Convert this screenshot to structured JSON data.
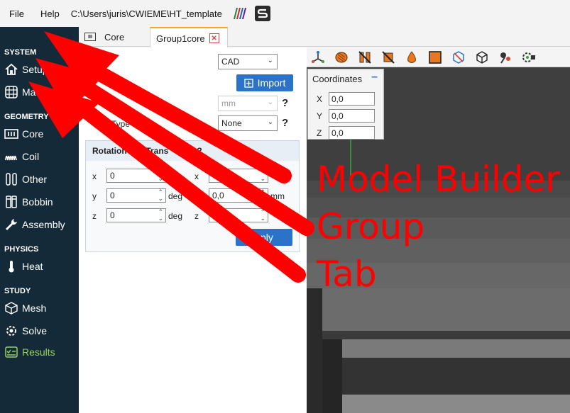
{
  "menubar": {
    "file": "File",
    "help": "Help",
    "path": "C:\\Users\\juris\\CWIEME\\HT_template"
  },
  "sidebar": {
    "sections": [
      {
        "label": "SYSTEM"
      },
      {
        "label": "GEOMETRY"
      },
      {
        "label": "PHYSICS"
      },
      {
        "label": "STUDY"
      }
    ],
    "items": {
      "setup": "Setup",
      "material": "Mate",
      "core": "Core",
      "coil": "Coil",
      "other": "Other",
      "bobbin": "Bobbin",
      "assembly": "Assembly",
      "heat": "Heat",
      "mesh": "Mesh",
      "solve": "Solve",
      "results": "Results"
    },
    "results_color": "#9ad35a"
  },
  "tabs": [
    {
      "label": "Core",
      "icon": "core-icon"
    },
    {
      "label": "Group1core",
      "active": true,
      "close_icon": "close-icon"
    }
  ],
  "panel": {
    "source_select": "CAD",
    "import_label": "Import",
    "unit_select": "mm",
    "type_label": "Type",
    "type_select": "None",
    "rotation_header": "Rotation",
    "rotation_header_tail": "l Trans",
    "rows": [
      {
        "axis": "x",
        "value": "0",
        "axis2": "x",
        "value2": ""
      },
      {
        "axis": "y",
        "value": "0",
        "unit": "deg",
        "axis2": "y",
        "value2": "0,0",
        "unit2": "mm"
      },
      {
        "axis": "z",
        "value": "0",
        "unit": "deg",
        "axis2": "z",
        "value2": ""
      }
    ],
    "apply_label": "pply",
    "qmark": "?",
    "accent": "#2a73c8"
  },
  "viewport": {
    "coords_title": "Coordinates",
    "coords": [
      {
        "axis": "X",
        "value": "0,0"
      },
      {
        "axis": "Y",
        "value": "0,0"
      },
      {
        "axis": "Z",
        "value": "0,0"
      }
    ],
    "toolbar_icons": [
      "axes-icon",
      "coil-shape-icon",
      "hide-coil-icon",
      "hide-other-icon",
      "drop-icon",
      "orange-square-icon",
      "cube-cross-icon",
      "wireframe-cube-icon",
      "probe-icon",
      "camera-gear-icon"
    ]
  },
  "annotations": {
    "line1": "Model Builder",
    "line2": "Group",
    "line3": "Tab",
    "color": "#ff0000"
  }
}
